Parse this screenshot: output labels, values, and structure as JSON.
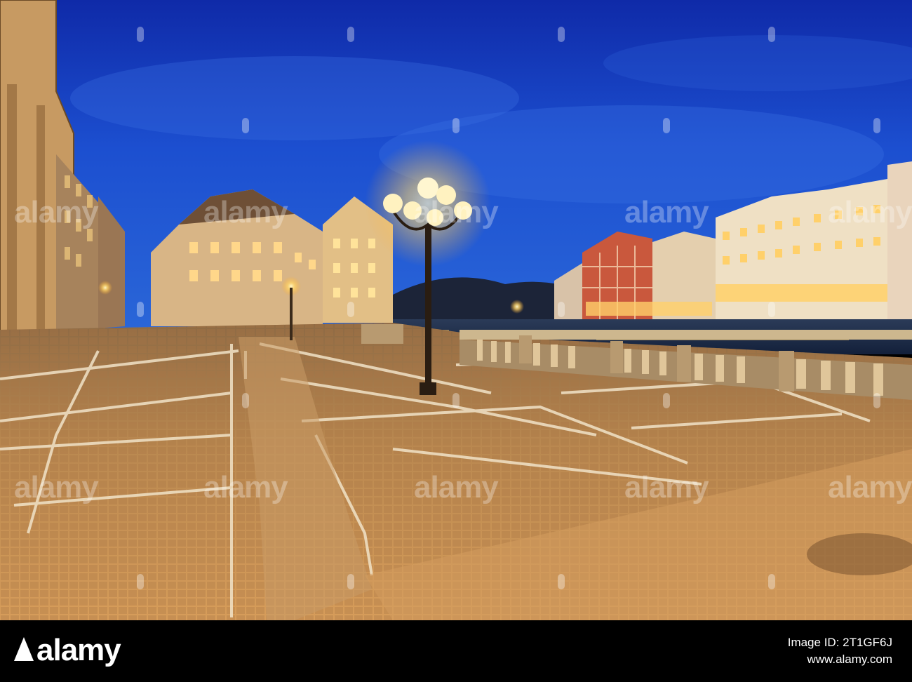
{
  "watermark": {
    "text": "alamy"
  },
  "footer": {
    "brand": "alamy",
    "image_id": "Image ID: 2T1GF6J",
    "site": "www.alamy.com"
  },
  "colors": {
    "sky": "#1a3fbf",
    "lamp_glow": "#ffd56a",
    "pavement": "#b8824a"
  }
}
